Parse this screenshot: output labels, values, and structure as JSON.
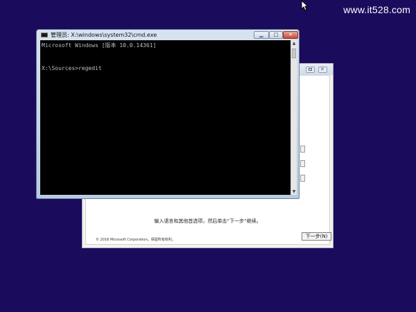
{
  "watermark": "www.it528.com",
  "cmd_window": {
    "title": "管理员: X:\\windows\\system32\\cmd.exe",
    "lines": [
      "Microsoft Windows [版本 10.0.14361]",
      "",
      "X:\\Sources>regedit"
    ]
  },
  "setup_window": {
    "hint": "输入语言和其他首选项，然后单击“下一步”继续。",
    "copyright": "© 2016 Microsoft Corporation。保留所有权利。",
    "next_button": "下一步(N)"
  },
  "colors": {
    "desktop": "#1b0b5c",
    "console": "#000000",
    "console_text": "#c0c0c0"
  }
}
